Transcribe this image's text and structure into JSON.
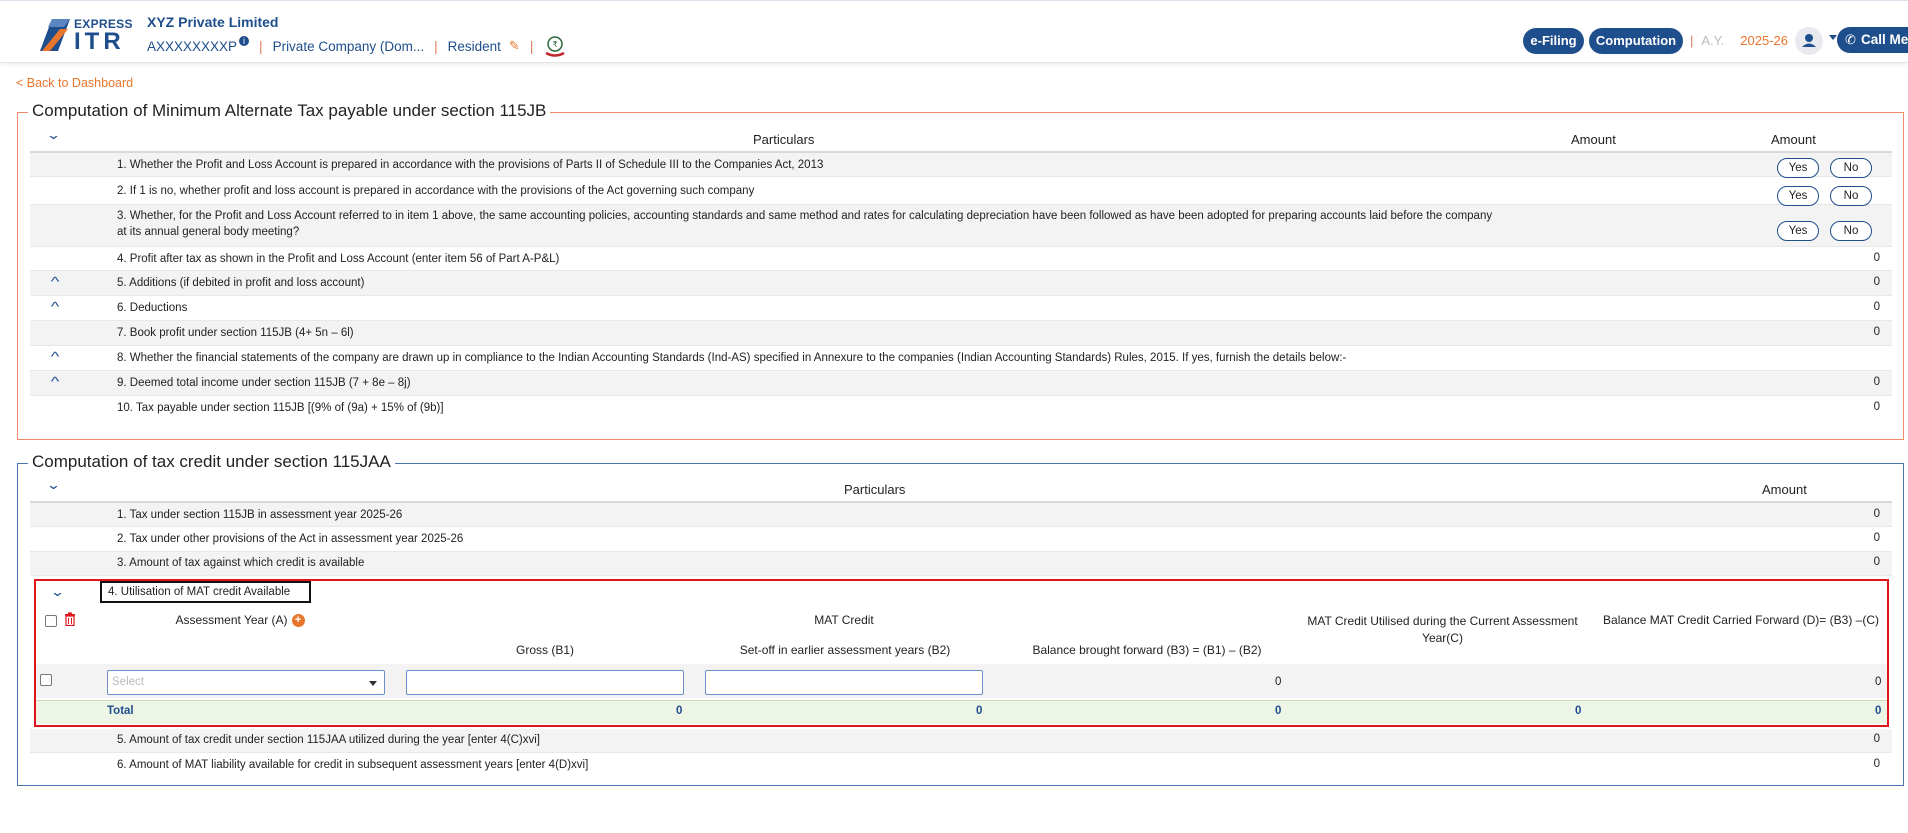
{
  "header": {
    "logo_top": "EXPRESS",
    "logo_main": "ITR",
    "company_name": "XYZ Private Limited",
    "pan": "AXXXXXXXXP",
    "info_badge": "i",
    "company_type": "Private Company (Dom...",
    "residency": "Resident",
    "efiling_label": "e-Filing",
    "computation_label": "Computation",
    "ay_label": "A.Y.",
    "ay_value": "2025-26",
    "call_label": "Call Me",
    "accent": "#1f4e8c",
    "orange": "#e8762c"
  },
  "back_link": "< Back to Dashboard",
  "mat_section": {
    "title": "Computation of Minimum Alternate Tax payable under section 115JB",
    "col_particulars": "Particulars",
    "col_amount1": "Amount",
    "col_amount2": "Amount",
    "yes_label": "Yes",
    "no_label": "No",
    "rows": [
      {
        "text": "1.  Whether the Profit and Loss Account is prepared in accordance with the provisions of Parts II of Schedule III to the Companies Act, 2013",
        "value": ""
      },
      {
        "text": "2.  If 1 is no, whether profit and loss account is prepared in accordance with the provisions of the Act governing such company",
        "value": ""
      },
      {
        "text": "3.  Whether, for the Profit and Loss Account referred to in item 1 above, the same accounting policies, accounting standards and same method and rates for calculating depreciation have been followed as have been adopted for preparing accounts laid before the company",
        "text2": "at its annual general body meeting?",
        "value": ""
      },
      {
        "text": "4.  Profit after tax as shown in the Profit and Loss Account (enter item 56 of Part A-P&L)",
        "value": "0"
      },
      {
        "text": "5.  Additions (if debited in profit and loss account)",
        "value": "0"
      },
      {
        "text": "6.  Deductions",
        "value": "0"
      },
      {
        "text": "7.  Book profit under section 115JB (4+ 5n – 6l)",
        "value": "0"
      },
      {
        "text": "8.  Whether the financial statements of the company are drawn up in compliance to the Indian Accounting Standards (Ind-AS) specified in Annexure to the companies (Indian Accounting Standards) Rules, 2015. If yes, furnish the details below:-",
        "value": ""
      },
      {
        "text": "9.  Deemed total income under section 115JB (7 + 8e – 8j)",
        "value": "0"
      },
      {
        "text": "10.  Tax payable under section 115JB [(9% of (9a) + 15% of (9b)]",
        "value": "0"
      }
    ]
  },
  "credit_section": {
    "title": "Computation of tax credit under section 115JAA",
    "col_particulars": "Particulars",
    "col_amount": "Amount",
    "rows": [
      {
        "text": "1.   Tax under section 115JB in assessment year 2025-26",
        "value": "0"
      },
      {
        "text": "2.  Tax under other provisions of the Act in assessment year 2025-26",
        "value": "0"
      },
      {
        "text": "3.  Amount of tax against which credit is available",
        "value": "0"
      }
    ],
    "utilisation": {
      "title": "4.  Utilisation of MAT credit Available",
      "col_assessment_year": "Assessment Year (A)",
      "col_mat_credit": "MAT Credit",
      "col_gross": "Gross (B1)",
      "col_setoff": "Set-off in earlier assessment years (B2)",
      "col_balance_bf": "Balance brought forward (B3) = (B1) – (B2)",
      "col_utilised": "MAT Credit Utilised during the Current Assessment Year(C)",
      "col_balance_cf": "Balance MAT Credit Carried Forward (D)= (B3) –(C)",
      "select_placeholder": "Select",
      "row_b3": "0",
      "row_d": "0",
      "total_label": "Total",
      "total_b1": "0",
      "total_b2": "0",
      "total_b3": "0",
      "total_c": "0",
      "total_d": "0"
    },
    "rows_after": [
      {
        "text": "5.  Amount of tax credit under section 115JAA utilized during the year [enter 4(C)xvi]",
        "value": "0"
      },
      {
        "text": "6.  Amount of MAT liability available for credit in subsequent assessment years [enter 4(D)xvi]",
        "value": "0"
      }
    ]
  }
}
